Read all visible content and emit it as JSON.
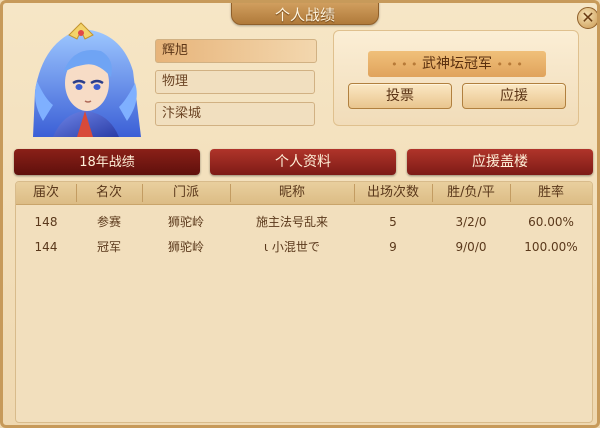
{
  "title": "个人战绩",
  "close_symbol": "✕",
  "player": {
    "name": "辉旭",
    "class": "物理",
    "location": "汴梁城"
  },
  "champion": {
    "title": "武神坛冠军",
    "vote_label": "投票",
    "support_label": "应援"
  },
  "tabs": [
    {
      "label": "18年战绩"
    },
    {
      "label": "个人资料"
    },
    {
      "label": "应援盖楼"
    }
  ],
  "table": {
    "headers": [
      "届次",
      "名次",
      "门派",
      "昵称",
      "出场次数",
      "胜/负/平",
      "胜率"
    ],
    "rows": [
      [
        "148",
        "参赛",
        "狮驼岭",
        "施主法号乱来",
        "5",
        "3/2/0",
        "60.00%"
      ],
      [
        "144",
        "冠军",
        "狮驼岭",
        "ι 小混世で",
        "9",
        "9/0/0",
        "100.00%"
      ]
    ]
  },
  "colors": {
    "tab_red": "#8a2018",
    "panel_bg": "#efd8b0",
    "accent_gold": "#e0a35c"
  }
}
